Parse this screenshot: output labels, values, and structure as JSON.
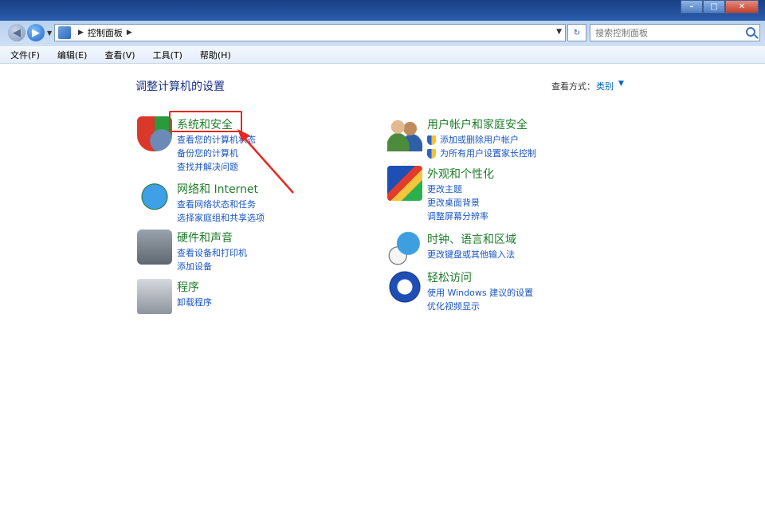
{
  "window": {
    "controls": {
      "minimize": "–",
      "maximize": "□",
      "close": "✕"
    }
  },
  "address": {
    "back_icon": "back-arrow-icon",
    "forward_icon": "forward-arrow-icon",
    "breadcrumb": "控制面板",
    "refresh_label": "↻",
    "search_placeholder": "搜索控制面板"
  },
  "menubar": {
    "items": [
      "文件(F)",
      "编辑(E)",
      "查看(V)",
      "工具(T)",
      "帮助(H)"
    ]
  },
  "content": {
    "heading": "调整计算机的设置",
    "view_by_label": "查看方式：",
    "view_by_value": "类别",
    "categories_left": [
      {
        "title": "系统和安全",
        "icon": "shield-icon",
        "links": [
          "查看您的计算机状态",
          "备份您的计算机",
          "查找并解决问题"
        ]
      },
      {
        "title": "网络和 Internet",
        "icon": "network-globe-icon",
        "links": [
          "查看网络状态和任务",
          "选择家庭组和共享选项"
        ]
      },
      {
        "title": "硬件和声音",
        "icon": "printer-icon",
        "links": [
          "查看设备和打印机",
          "添加设备"
        ]
      },
      {
        "title": "程序",
        "icon": "programs-icon",
        "links": [
          "卸载程序"
        ]
      }
    ],
    "categories_right": [
      {
        "title": "用户帐户和家庭安全",
        "icon": "users-icon",
        "links": [
          "添加或删除用户帐户",
          "为所有用户设置家长控制"
        ]
      },
      {
        "title": "外观和个性化",
        "icon": "appearance-icon",
        "links": [
          "更改主题",
          "更改桌面背景",
          "调整屏幕分辨率"
        ]
      },
      {
        "title": "时钟、语言和区域",
        "icon": "clock-globe-icon",
        "links": [
          "更改键盘或其他输入法"
        ]
      },
      {
        "title": "轻松访问",
        "icon": "ease-of-access-icon",
        "links": [
          "使用 Windows 建议的设置",
          "优化视频显示"
        ]
      }
    ]
  },
  "annotation": {
    "highlight_color": "#e52920"
  }
}
